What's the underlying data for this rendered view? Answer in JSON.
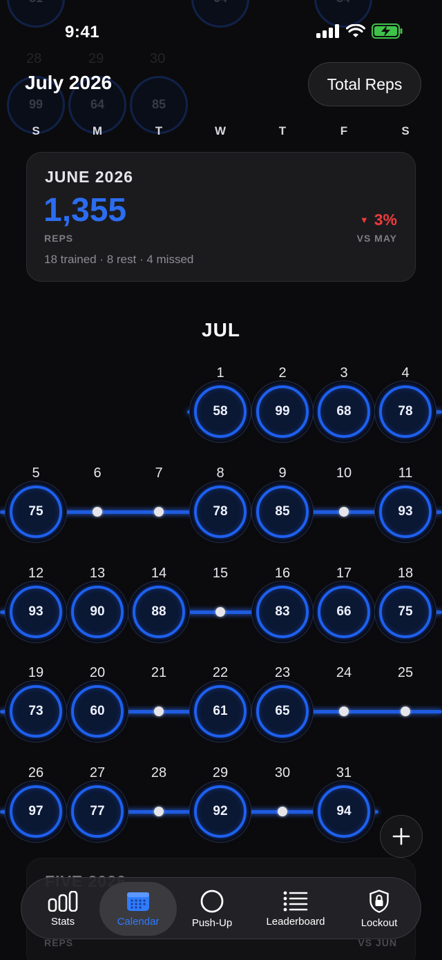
{
  "status_bar": {
    "time": "9:41"
  },
  "header": {
    "month_title": "July 2026",
    "total_reps_button": "Total Reps"
  },
  "weekdays": [
    "S",
    "M",
    "T",
    "W",
    "T",
    "F",
    "S"
  ],
  "ghost_remnants": {
    "numbers": [
      "28",
      "29",
      "30"
    ],
    "circles": [
      "99",
      "64",
      "85",
      "81",
      "64",
      "84"
    ]
  },
  "summary": {
    "title": "JUNE 2026",
    "total": "1,355",
    "unit": "REPS",
    "change": "3%",
    "change_direction": "down",
    "change_color": "#ef3b3b",
    "vs": "VS MAY",
    "detail": "18 trained · 8 rest · 4 missed"
  },
  "calendar": {
    "month_label": "JUL",
    "accent": "#1e60ee",
    "days": [
      {
        "d": "1",
        "reps": "58"
      },
      {
        "d": "2",
        "reps": "99"
      },
      {
        "d": "3",
        "reps": "68"
      },
      {
        "d": "4",
        "reps": "78"
      },
      {
        "d": "5",
        "reps": "75"
      },
      {
        "d": "6",
        "reps": null
      },
      {
        "d": "7",
        "reps": null
      },
      {
        "d": "8",
        "reps": "78"
      },
      {
        "d": "9",
        "reps": "85"
      },
      {
        "d": "10",
        "reps": null
      },
      {
        "d": "11",
        "reps": "93"
      },
      {
        "d": "12",
        "reps": "93"
      },
      {
        "d": "13",
        "reps": "90"
      },
      {
        "d": "14",
        "reps": "88"
      },
      {
        "d": "15",
        "reps": null
      },
      {
        "d": "16",
        "reps": "83"
      },
      {
        "d": "17",
        "reps": "66"
      },
      {
        "d": "18",
        "reps": "75"
      },
      {
        "d": "19",
        "reps": "73"
      },
      {
        "d": "20",
        "reps": "60"
      },
      {
        "d": "21",
        "reps": null
      },
      {
        "d": "22",
        "reps": "61"
      },
      {
        "d": "23",
        "reps": "65"
      },
      {
        "d": "24",
        "reps": null
      },
      {
        "d": "25",
        "reps": null
      },
      {
        "d": "26",
        "reps": "97"
      },
      {
        "d": "27",
        "reps": "77"
      },
      {
        "d": "28",
        "reps": null
      },
      {
        "d": "29",
        "reps": "92"
      },
      {
        "d": "30",
        "reps": null
      },
      {
        "d": "31",
        "reps": "94"
      }
    ]
  },
  "next_card": {
    "title": "FIVE 2026",
    "unit": "REPS",
    "vs": "VS JUN"
  },
  "tabs": [
    {
      "label": "Stats",
      "icon": "bar-chart-icon"
    },
    {
      "label": "Calendar",
      "icon": "calendar-icon",
      "active": true
    },
    {
      "label": "Push-Up",
      "icon": "circle-icon"
    },
    {
      "label": "Leaderboard",
      "icon": "list-icon"
    },
    {
      "label": "Lockout",
      "icon": "lock-icon"
    }
  ]
}
